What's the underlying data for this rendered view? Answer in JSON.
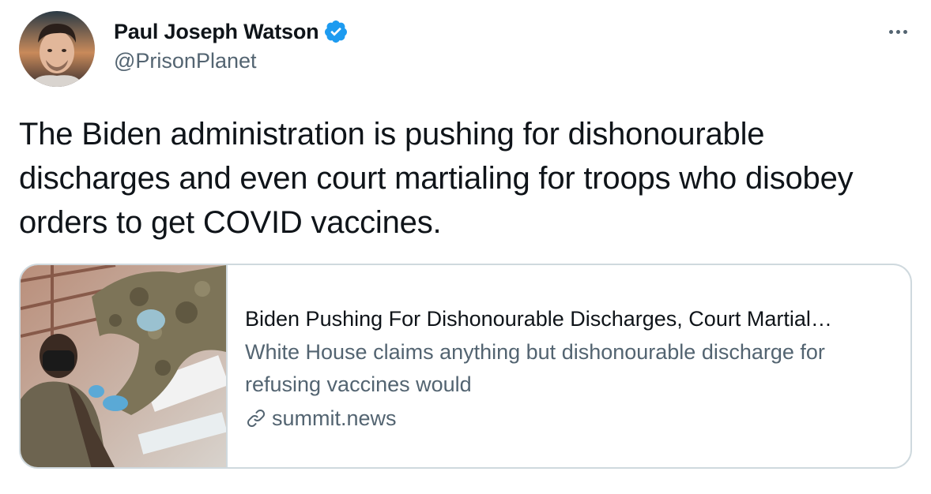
{
  "author": {
    "display_name": "Paul Joseph Watson",
    "handle": "@PrisonPlanet",
    "verified": true
  },
  "tweet": {
    "text": "The Biden administration is pushing for dishonourable discharges and even court martialing for troops who disobey orders to get COVID vaccines."
  },
  "card": {
    "title": "Biden Pushing For Dishonourable Discharges, Court Martial…",
    "description": "White House claims anything but dishonourable discharge for refusing vaccines would",
    "domain": "summit.news",
    "image_icon": "soldier-vaccination-photo"
  },
  "icons": {
    "verified": "verified-badge-icon",
    "more": "more-options-icon",
    "link": "link-icon"
  },
  "colors": {
    "text_primary": "#0f1419",
    "text_secondary": "#536471",
    "verified_blue": "#1d9bf0",
    "border": "#cfd9de"
  }
}
